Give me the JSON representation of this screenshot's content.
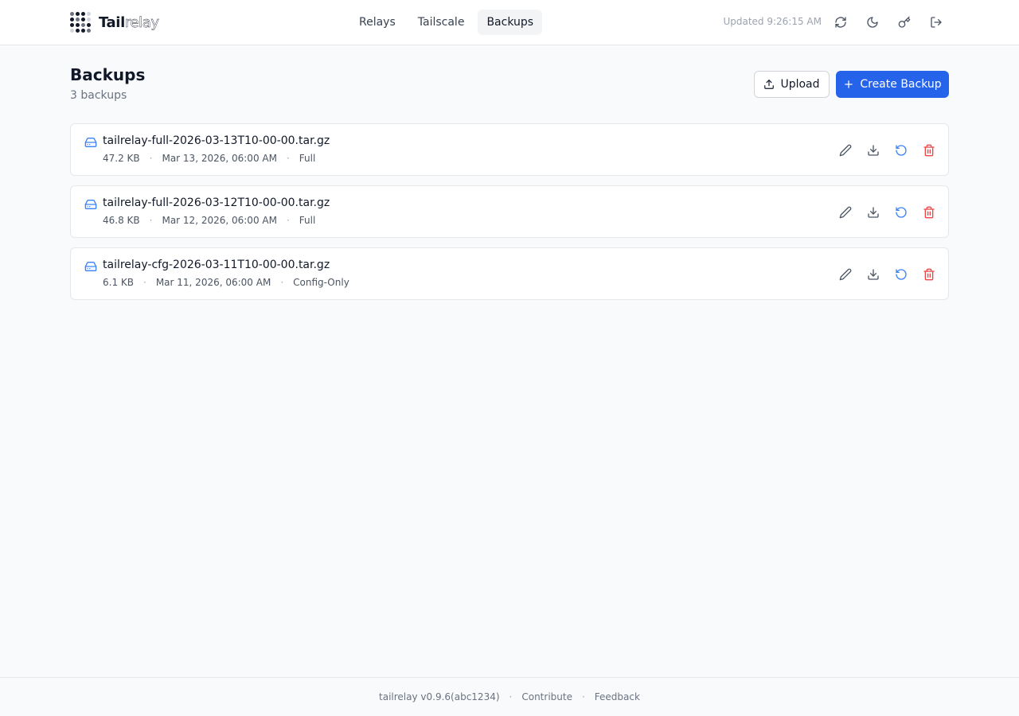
{
  "app": {
    "brand_strong": "Tail",
    "brand_light": "relay",
    "logo_icon": "dot-grid-logo"
  },
  "nav": {
    "items": [
      {
        "label": "Relays",
        "active": false
      },
      {
        "label": "Tailscale",
        "active": false
      },
      {
        "label": "Backups",
        "active": true
      }
    ]
  },
  "header": {
    "updated": "Updated 9:26:15 AM",
    "icons": [
      "refresh-icon",
      "moon-icon",
      "key-icon",
      "logout-icon"
    ]
  },
  "page": {
    "title": "Backups",
    "subtitle": "3 backups",
    "upload_label": "Upload",
    "create_label": "Create Backup"
  },
  "backups": [
    {
      "name": "tailrelay-full-2026-03-13T10-00-00.tar.gz",
      "size": "47.2 KB",
      "date": "Mar 13, 2026, 06:00 AM",
      "type": "Full"
    },
    {
      "name": "tailrelay-full-2026-03-12T10-00-00.tar.gz",
      "size": "46.8 KB",
      "date": "Mar 12, 2026, 06:00 AM",
      "type": "Full"
    },
    {
      "name": "tailrelay-cfg-2026-03-11T10-00-00.tar.gz",
      "size": "6.1 KB",
      "date": "Mar 11, 2026, 06:00 AM",
      "type": "Config-Only"
    }
  ],
  "footer": {
    "version": "tailrelay v0.9.6(abc1234)",
    "separator": "·",
    "contribute": "Contribute",
    "feedback": "Feedback"
  },
  "colors": {
    "accent": "#2563eb",
    "icon_blue": "#3b82f6",
    "danger": "#ef4444"
  }
}
